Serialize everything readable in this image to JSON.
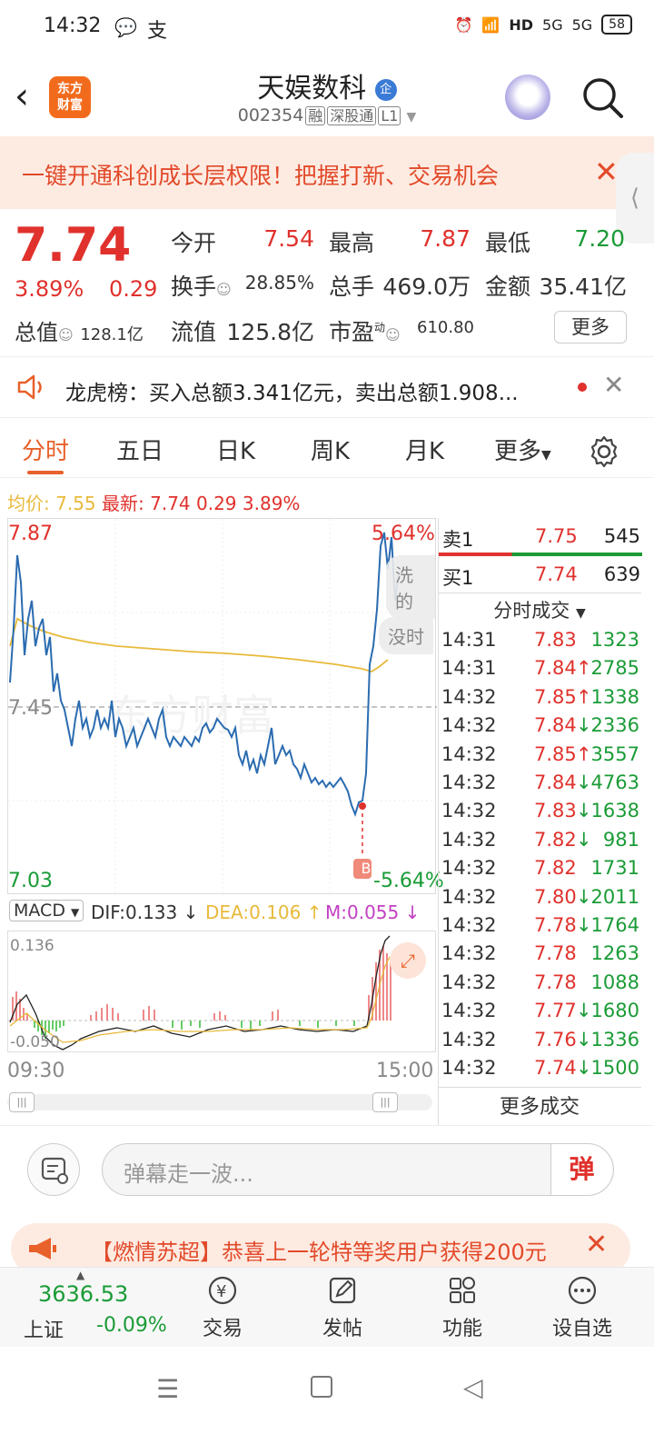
{
  "status_bar": {
    "time": "14:32",
    "app_icons": [
      "wechat-icon",
      "alipay-icon"
    ],
    "hd_label": "HD",
    "signal_label": "5G",
    "battery": "58"
  },
  "header": {
    "back_icon": "back-arrow-icon",
    "logo_line1": "东方",
    "logo_line2": "财富",
    "stock_name": "天娱数科",
    "stock_badge": "企",
    "stock_code": "002354",
    "tags": [
      "融",
      "深股通",
      "L1"
    ]
  },
  "banner": {
    "text": "一键开通科创成长层权限！把握打新、交易机会",
    "close": "✕"
  },
  "quote": {
    "price": "7.74",
    "change_pct": "3.89%",
    "change": "0.29",
    "open_label": "今开",
    "open": "7.54",
    "high_label": "最高",
    "high": "7.87",
    "low_label": "最低",
    "low": "7.20",
    "turnover_label": "换手",
    "turnover": "28.85%",
    "volume_label": "总手",
    "volume": "469.0万",
    "amount_label": "金额",
    "amount": "35.41亿",
    "mktcap_label": "总值",
    "mktcap": "128.1亿",
    "float_label": "流值",
    "float": "125.8亿",
    "pe_label": "市盈",
    "pe_sup": "动",
    "pe": "610.80",
    "more": "更多"
  },
  "ticker": {
    "text": "龙虎榜：买入总额3.341亿元，卖出总额1.908..."
  },
  "tabs": [
    "分时",
    "五日",
    "日K",
    "周K",
    "月K",
    "更多"
  ],
  "avg_line": {
    "avg_label": "均价:",
    "avg": "7.55",
    "last_label": "最新:",
    "last": "7.74",
    "chg": "0.29",
    "chg_pct": "3.89%"
  },
  "chart_labels": {
    "top_price": "7.87",
    "mid_price": "7.45",
    "bottom_price": "7.03",
    "top_pct": "5.64%",
    "bottom_pct": "-5.64%",
    "pill1": "洗的",
    "pill2": "没时",
    "marker": "B",
    "watermark": "东方财富"
  },
  "macd": {
    "select": "MACD",
    "dif": "DIF:0.133",
    "dea": "DEA:0.106",
    "m": "M:0.055",
    "top": "0.136",
    "bottom": "-0.050"
  },
  "time_axis": {
    "start": "09:30",
    "end": "15:00"
  },
  "order_book": {
    "ask_label": "卖1",
    "ask_price": "7.75",
    "ask_vol": "545",
    "bid_label": "买1",
    "bid_price": "7.74",
    "bid_vol": "639"
  },
  "trades_title": "分时成交",
  "trades": [
    {
      "time": "14:31",
      "price": "7.83",
      "arrow": "",
      "vol": "1323"
    },
    {
      "time": "14:31",
      "price": "7.84",
      "arrow": "↑",
      "vol": "2785"
    },
    {
      "time": "14:32",
      "price": "7.85",
      "arrow": "↑",
      "vol": "1338"
    },
    {
      "time": "14:32",
      "price": "7.84",
      "arrow": "↓",
      "vol": "2336"
    },
    {
      "time": "14:32",
      "price": "7.85",
      "arrow": "↑",
      "vol": "3557"
    },
    {
      "time": "14:32",
      "price": "7.84",
      "arrow": "↓",
      "vol": "4763"
    },
    {
      "time": "14:32",
      "price": "7.83",
      "arrow": "↓",
      "vol": "1638"
    },
    {
      "time": "14:32",
      "price": "7.82",
      "arrow": "↓",
      "vol": "981"
    },
    {
      "time": "14:32",
      "price": "7.82",
      "arrow": "",
      "vol": "1731"
    },
    {
      "time": "14:32",
      "price": "7.80",
      "arrow": "↓",
      "vol": "2011"
    },
    {
      "time": "14:32",
      "price": "7.78",
      "arrow": "↓",
      "vol": "1764"
    },
    {
      "time": "14:32",
      "price": "7.78",
      "arrow": "",
      "vol": "1263"
    },
    {
      "time": "14:32",
      "price": "7.78",
      "arrow": "",
      "vol": "1088"
    },
    {
      "time": "14:32",
      "price": "7.77",
      "arrow": "↓",
      "vol": "1680"
    },
    {
      "time": "14:32",
      "price": "7.76",
      "arrow": "↓",
      "vol": "1336"
    },
    {
      "time": "14:32",
      "price": "7.74",
      "arrow": "↓",
      "vol": "1500"
    }
  ],
  "more_trades": "更多成交",
  "danmu": {
    "placeholder": "弹幕走一波...",
    "button": "弹"
  },
  "promo": {
    "text": "【燃情苏超】恭喜上一轮特等奖用户获得200元",
    "close": "✕"
  },
  "bottom_nav": {
    "index_value": "3636.53",
    "index_name": "上证",
    "index_change": "-0.09%",
    "items": [
      "交易",
      "发帖",
      "功能",
      "设自选"
    ]
  },
  "colors": {
    "up": "#e0312c",
    "down": "#1a9b36",
    "accent": "#e8602a",
    "price_line": "#2b6cb0",
    "avg_line": "#e8b93a"
  }
}
